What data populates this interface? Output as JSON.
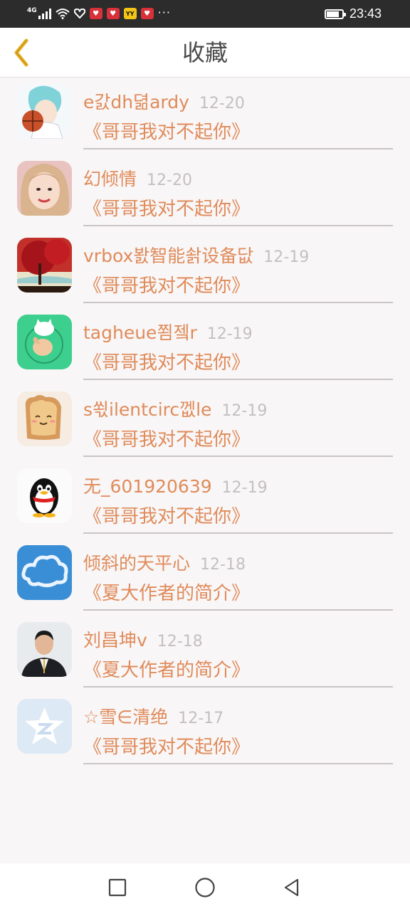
{
  "status_bar": {
    "network": "4G",
    "time": "23:43",
    "battery_level": 0.8,
    "app_icons": [
      "app-red-icon",
      "app-red-icon",
      "app-yellow-icon",
      "app-red-icon"
    ],
    "more": "···"
  },
  "header": {
    "title": "收藏",
    "back_icon": "chevron-left-icon",
    "accent": "#e8b020"
  },
  "colors": {
    "name": "#e08b5a",
    "date": "#c4c0c2",
    "background": "#f8f6f7"
  },
  "items": [
    {
      "name": "e갌dh뎖ardy",
      "date": "12-20",
      "article": "《哥哥我对不起你》",
      "avatar": "anime-basketball-avatar"
    },
    {
      "name": "幻倾情",
      "date": "12-20",
      "article": "《哥哥我对不起你》",
      "avatar": "girl-photo-avatar"
    },
    {
      "name": "vrbox봜智能솱设备닶",
      "date": "12-19",
      "article": "《哥哥我对不起你》",
      "avatar": "red-tree-avatar"
    },
    {
      "name": "tagheue쬠젴r",
      "date": "12-19",
      "article": "《哥哥我对不起你》",
      "avatar": "cat-hand-avatar"
    },
    {
      "name": "s쐯ilentcirc껪le",
      "date": "12-19",
      "article": "《哥哥我对不起你》",
      "avatar": "toast-avatar"
    },
    {
      "name": "无_601920639",
      "date": "12-19",
      "article": "《哥哥我对不起你》",
      "avatar": "qq-penguin-avatar"
    },
    {
      "name": "倾斜的天平心",
      "date": "12-18",
      "article": "《夏大作者的简介》",
      "avatar": "cloud-avatar"
    },
    {
      "name": "刘昌坤v",
      "date": "12-18",
      "article": "《夏大作者的简介》",
      "avatar": "man-photo-avatar"
    },
    {
      "name": "☆雪∈清绝",
      "date": "12-17",
      "article": "《哥哥我对不起你》",
      "avatar": "qzone-star-avatar"
    }
  ],
  "nav_bar": {
    "buttons": [
      "recents-square-icon",
      "home-circle-icon",
      "back-triangle-icon"
    ]
  }
}
